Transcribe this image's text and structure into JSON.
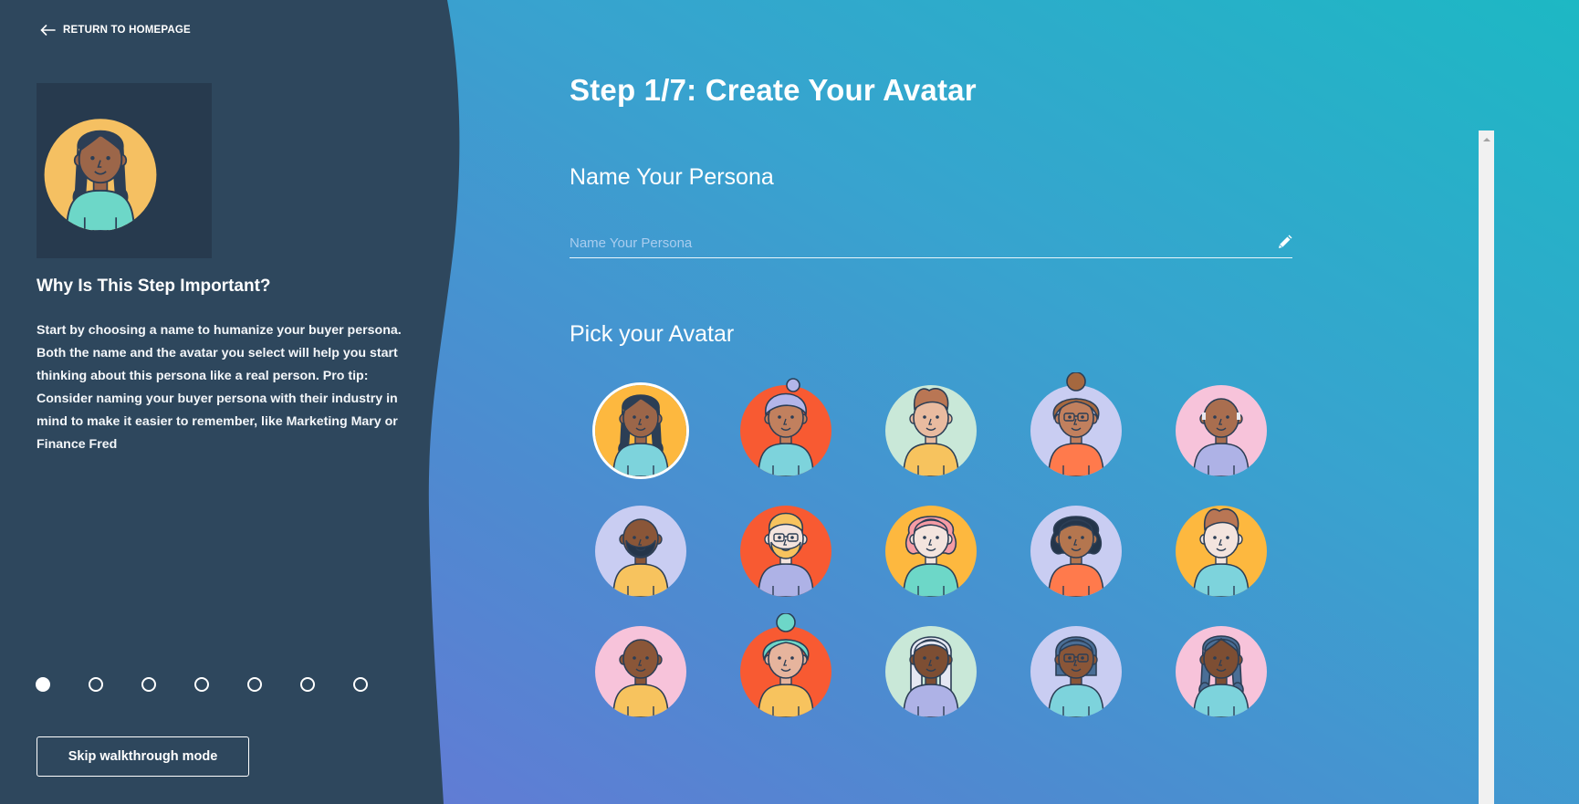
{
  "nav": {
    "back_label": "RETURN TO HOMEPAGE",
    "back_icon": "arrow-left-icon"
  },
  "sidebar": {
    "selected_avatar_index": 0,
    "why_title": "Why Is This Step Important?",
    "why_body": "Start by choosing a name to humanize your buyer persona. Both the name and the avatar you select will help you start thinking about this persona like a real person. Pro tip: Consider naming your buyer persona with their industry in mind to make it easier to remember, like Marketing Mary or Finance Fred",
    "steps": {
      "total": 7,
      "current": 1
    },
    "skip_label": "Skip walkthrough mode"
  },
  "main": {
    "title": "Step 1/7: Create Your Avatar",
    "name_section_title": "Name Your Persona",
    "name_input": {
      "value": "",
      "placeholder": "Name Your Persona",
      "icon": "pencil-icon"
    },
    "avatar_section_title": "Pick your Avatar",
    "avatars": [
      {
        "id": "braids-girl",
        "bg": "#FDB83F",
        "skin": "#9C6649",
        "hair": "#2C3E55",
        "shirt": "#7DD3DC",
        "hair_style": "braids",
        "selected": true
      },
      {
        "id": "grey-bun-woman",
        "bg": "#F85A32",
        "skin": "#C1805E",
        "hair": "#B3B6EA",
        "shirt": "#7DD3DC",
        "hair_style": "bun"
      },
      {
        "id": "quiff-man",
        "bg": "#C9E8D8",
        "skin": "#E9BBA0",
        "hair": "#B97654",
        "shirt": "#F7C35E",
        "hair_style": "quiff"
      },
      {
        "id": "curly-glasses-woman",
        "bg": "#C9CDF2",
        "skin": "#C1805E",
        "hair": "#A5683F",
        "shirt": "#FF7A4C",
        "hair_style": "curly-bun",
        "glasses": true
      },
      {
        "id": "bald-old-man",
        "bg": "#F7C3DA",
        "skin": "#A96E4F",
        "hair": "#E9E9F0",
        "shirt": "#AEB2E6",
        "hair_style": "bald-sides"
      },
      {
        "id": "bearded-man",
        "bg": "#C9CDF2",
        "skin": "#8A5638",
        "hair": "#24354A",
        "shirt": "#F7C35E",
        "hair_style": "beard"
      },
      {
        "id": "blond-hipster",
        "bg": "#F85A32",
        "skin": "#F3E4DE",
        "hair": "#F7C35E",
        "shirt": "#AEB2E6",
        "hair_style": "blond-beard",
        "glasses": true
      },
      {
        "id": "pink-hair-woman",
        "bg": "#FDB83F",
        "skin": "#F3E4DE",
        "hair": "#F59CA5",
        "shirt": "#6DD7C8",
        "hair_style": "wavy"
      },
      {
        "id": "dark-curly-woman",
        "bg": "#C9CDF2",
        "skin": "#B4764F",
        "hair": "#24354A",
        "shirt": "#FF7A4C",
        "hair_style": "wavy"
      },
      {
        "id": "brown-hair-boy",
        "bg": "#FDB83F",
        "skin": "#F3E4DE",
        "hair": "#B97654",
        "shirt": "#7DD3DC",
        "hair_style": "quiff"
      },
      {
        "id": "bald-man",
        "bg": "#F7C3DA",
        "skin": "#8A5638",
        "hair": "#8A5638",
        "shirt": "#F7C35E",
        "hair_style": "bald"
      },
      {
        "id": "teal-curly-woman",
        "bg": "#F85A32",
        "skin": "#E6B49D",
        "hair": "#6DD7C8",
        "shirt": "#F7C35E",
        "hair_style": "curly-bun"
      },
      {
        "id": "silver-hair-woman",
        "bg": "#C9E8D8",
        "skin": "#7D4E33",
        "hair": "#E5E7F2",
        "shirt": "#AEB2E6",
        "hair_style": "long"
      },
      {
        "id": "glasses-bob-woman",
        "bg": "#C9CDF2",
        "skin": "#8A5638",
        "hair": "#4A6E96",
        "shirt": "#7DD3DC",
        "hair_style": "bob",
        "glasses": true
      },
      {
        "id": "blue-braids-girl",
        "bg": "#F7C3DA",
        "skin": "#7D4E33",
        "hair": "#4A6E96",
        "shirt": "#7DD3DC",
        "hair_style": "braids"
      }
    ]
  },
  "colors": {
    "sidebar": "#2E475D",
    "gradient_start": "#6E72D8",
    "gradient_end": "#1DB8C4",
    "outline": "#2C3E55"
  }
}
